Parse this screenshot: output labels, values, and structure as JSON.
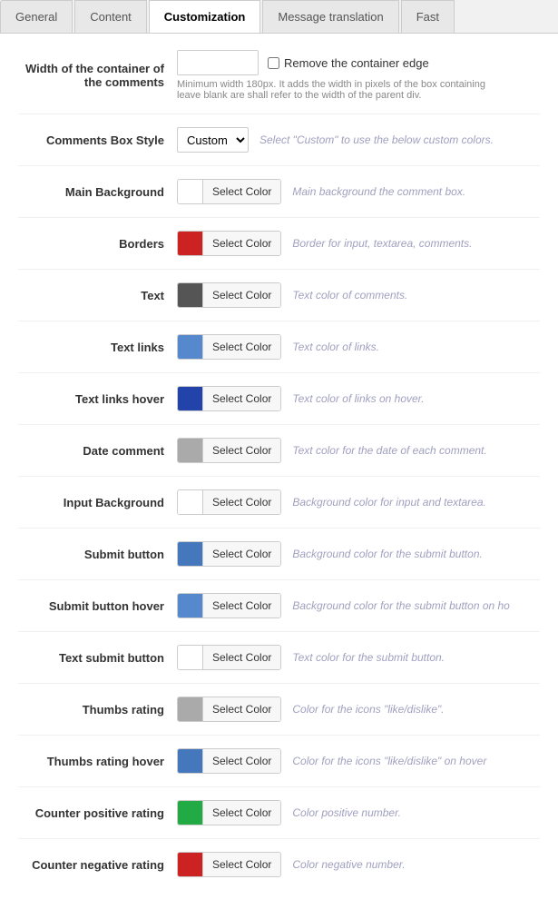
{
  "tabs": [
    {
      "label": "General",
      "active": false
    },
    {
      "label": "Content",
      "active": false
    },
    {
      "label": "Customization",
      "active": true
    },
    {
      "label": "Message translation",
      "active": false
    },
    {
      "label": "Fast",
      "active": false
    }
  ],
  "sections": {
    "width_label": "Width of the container of the comments",
    "width_placeholder": "",
    "width_checkbox_label": "Remove the container edge",
    "width_hint": "Minimum width 180px. It adds the width in pixels of the box containing leave blank are shall refer to the width of the parent div.",
    "box_style_label": "Comments Box Style",
    "box_style_value": "Custom",
    "box_style_hint": "Select \"Custom\" to use the below custom colors.",
    "rows": [
      {
        "label": "Main Background",
        "color": "#ffffff",
        "hint": "Main background the comment box.",
        "btn": "Select Color"
      },
      {
        "label": "Borders",
        "color": "#cc2222",
        "hint": "Border for input, textarea, comments.",
        "btn": "Select Color"
      },
      {
        "label": "Text",
        "color": "#555555",
        "hint": "Text color of comments.",
        "btn": "Select Color"
      },
      {
        "label": "Text links",
        "color": "#5588cc",
        "hint": "Text color of links.",
        "btn": "Select Color"
      },
      {
        "label": "Text links hover",
        "color": "#2244aa",
        "hint": "Text color of links on hover.",
        "btn": "Select Color"
      },
      {
        "label": "Date comment",
        "color": "#aaaaaa",
        "hint": "Text color for the date of each comment.",
        "btn": "Select Color"
      },
      {
        "label": "Input Background",
        "color": "#ffffff",
        "hint": "Background color for input and textarea.",
        "btn": "Select Color"
      },
      {
        "label": "Submit button",
        "color": "#4477bb",
        "hint": "Background color for the submit button.",
        "btn": "Select Color"
      },
      {
        "label": "Submit button hover",
        "color": "#5588cc",
        "hint": "Background color for the submit button on ho",
        "btn": "Select Color"
      },
      {
        "label": "Text submit button",
        "color": "#ffffff",
        "hint": "Text color for the submit button.",
        "btn": "Select Color"
      },
      {
        "label": "Thumbs rating",
        "color": "#aaaaaa",
        "hint": "Color for the icons \"like/dislike\".",
        "btn": "Select Color"
      },
      {
        "label": "Thumbs rating hover",
        "color": "#4477bb",
        "hint": "Color for the icons \"like/dislike\" on hover",
        "btn": "Select Color"
      },
      {
        "label": "Counter positive rating",
        "color": "#22aa44",
        "hint": "Color positive number.",
        "btn": "Select Color"
      },
      {
        "label": "Counter negative rating",
        "color": "#cc2222",
        "hint": "Color negative number.",
        "btn": "Select Color"
      }
    ]
  }
}
